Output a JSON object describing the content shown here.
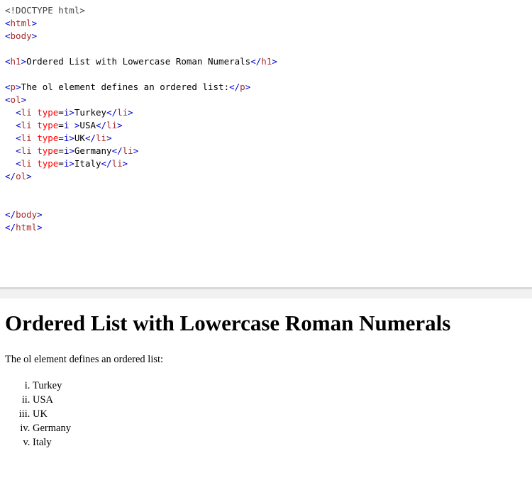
{
  "code_lines": [
    [
      {
        "t": "dt",
        "s": "<!DOCTYPE html>"
      }
    ],
    [
      {
        "t": "brk",
        "s": "<"
      },
      {
        "t": "tag",
        "s": "html"
      },
      {
        "t": "brk",
        "s": ">"
      }
    ],
    [
      {
        "t": "brk",
        "s": "<"
      },
      {
        "t": "tag",
        "s": "body"
      },
      {
        "t": "brk",
        "s": ">"
      }
    ],
    [],
    [
      {
        "t": "brk",
        "s": "<"
      },
      {
        "t": "tag",
        "s": "h1"
      },
      {
        "t": "brk",
        "s": ">"
      },
      {
        "t": "text",
        "s": "Ordered List with Lowercase Roman Numerals"
      },
      {
        "t": "brk",
        "s": "</"
      },
      {
        "t": "tag",
        "s": "h1"
      },
      {
        "t": "brk",
        "s": ">"
      }
    ],
    [],
    [
      {
        "t": "brk",
        "s": "<"
      },
      {
        "t": "tag",
        "s": "p"
      },
      {
        "t": "brk",
        "s": ">"
      },
      {
        "t": "text",
        "s": "The ol element defines an ordered list:"
      },
      {
        "t": "brk",
        "s": "</"
      },
      {
        "t": "tag",
        "s": "p"
      },
      {
        "t": "brk",
        "s": ">"
      }
    ],
    [
      {
        "t": "brk",
        "s": "<"
      },
      {
        "t": "tag",
        "s": "ol"
      },
      {
        "t": "brk",
        "s": ">"
      }
    ],
    [
      {
        "t": "text",
        "s": "  "
      },
      {
        "t": "brk",
        "s": "<"
      },
      {
        "t": "tag",
        "s": "li"
      },
      {
        "t": "text",
        "s": " "
      },
      {
        "t": "attr",
        "s": "type"
      },
      {
        "t": "text",
        "s": "="
      },
      {
        "t": "val",
        "s": "i"
      },
      {
        "t": "brk",
        "s": ">"
      },
      {
        "t": "text",
        "s": "Turkey"
      },
      {
        "t": "brk",
        "s": "</"
      },
      {
        "t": "tag",
        "s": "li"
      },
      {
        "t": "brk",
        "s": ">"
      }
    ],
    [
      {
        "t": "text",
        "s": "  "
      },
      {
        "t": "brk",
        "s": "<"
      },
      {
        "t": "tag",
        "s": "li"
      },
      {
        "t": "text",
        "s": " "
      },
      {
        "t": "attr",
        "s": "type"
      },
      {
        "t": "text",
        "s": "="
      },
      {
        "t": "val",
        "s": "i"
      },
      {
        "t": "text",
        "s": " "
      },
      {
        "t": "brk",
        "s": ">"
      },
      {
        "t": "text",
        "s": "USA"
      },
      {
        "t": "brk",
        "s": "</"
      },
      {
        "t": "tag",
        "s": "li"
      },
      {
        "t": "brk",
        "s": ">"
      }
    ],
    [
      {
        "t": "text",
        "s": "  "
      },
      {
        "t": "brk",
        "s": "<"
      },
      {
        "t": "tag",
        "s": "li"
      },
      {
        "t": "text",
        "s": " "
      },
      {
        "t": "attr",
        "s": "type"
      },
      {
        "t": "text",
        "s": "="
      },
      {
        "t": "val",
        "s": "i"
      },
      {
        "t": "brk",
        "s": ">"
      },
      {
        "t": "text",
        "s": "UK"
      },
      {
        "t": "brk",
        "s": "</"
      },
      {
        "t": "tag",
        "s": "li"
      },
      {
        "t": "brk",
        "s": ">"
      }
    ],
    [
      {
        "t": "text",
        "s": "  "
      },
      {
        "t": "brk",
        "s": "<"
      },
      {
        "t": "tag",
        "s": "li"
      },
      {
        "t": "text",
        "s": " "
      },
      {
        "t": "attr",
        "s": "type"
      },
      {
        "t": "text",
        "s": "="
      },
      {
        "t": "val",
        "s": "i"
      },
      {
        "t": "brk",
        "s": ">"
      },
      {
        "t": "text",
        "s": "Germany"
      },
      {
        "t": "brk",
        "s": "</"
      },
      {
        "t": "tag",
        "s": "li"
      },
      {
        "t": "brk",
        "s": ">"
      }
    ],
    [
      {
        "t": "text",
        "s": "  "
      },
      {
        "t": "brk",
        "s": "<"
      },
      {
        "t": "tag",
        "s": "li"
      },
      {
        "t": "text",
        "s": " "
      },
      {
        "t": "attr",
        "s": "type"
      },
      {
        "t": "text",
        "s": "="
      },
      {
        "t": "val",
        "s": "i"
      },
      {
        "t": "brk",
        "s": ">"
      },
      {
        "t": "text",
        "s": "Italy"
      },
      {
        "t": "brk",
        "s": "</"
      },
      {
        "t": "tag",
        "s": "li"
      },
      {
        "t": "brk",
        "s": ">"
      }
    ],
    [
      {
        "t": "brk",
        "s": "</"
      },
      {
        "t": "tag",
        "s": "ol"
      },
      {
        "t": "brk",
        "s": ">"
      }
    ],
    [],
    [],
    [
      {
        "t": "brk",
        "s": "</"
      },
      {
        "t": "tag",
        "s": "body"
      },
      {
        "t": "brk",
        "s": ">"
      }
    ],
    [
      {
        "t": "brk",
        "s": "</"
      },
      {
        "t": "tag",
        "s": "html"
      },
      {
        "t": "brk",
        "s": ">"
      }
    ]
  ],
  "result": {
    "heading": "Ordered List with Lowercase Roman Numerals",
    "paragraph": "The ol element defines an ordered list:",
    "list_items": [
      "Turkey",
      "USA",
      "UK",
      "Germany",
      "Italy"
    ]
  },
  "colors": {
    "tag": "#a52a2a",
    "bracket": "#0000cd",
    "attribute": "#ff0000",
    "value": "#0000cd",
    "text": "#000000",
    "divider": "#d9d9d9"
  }
}
